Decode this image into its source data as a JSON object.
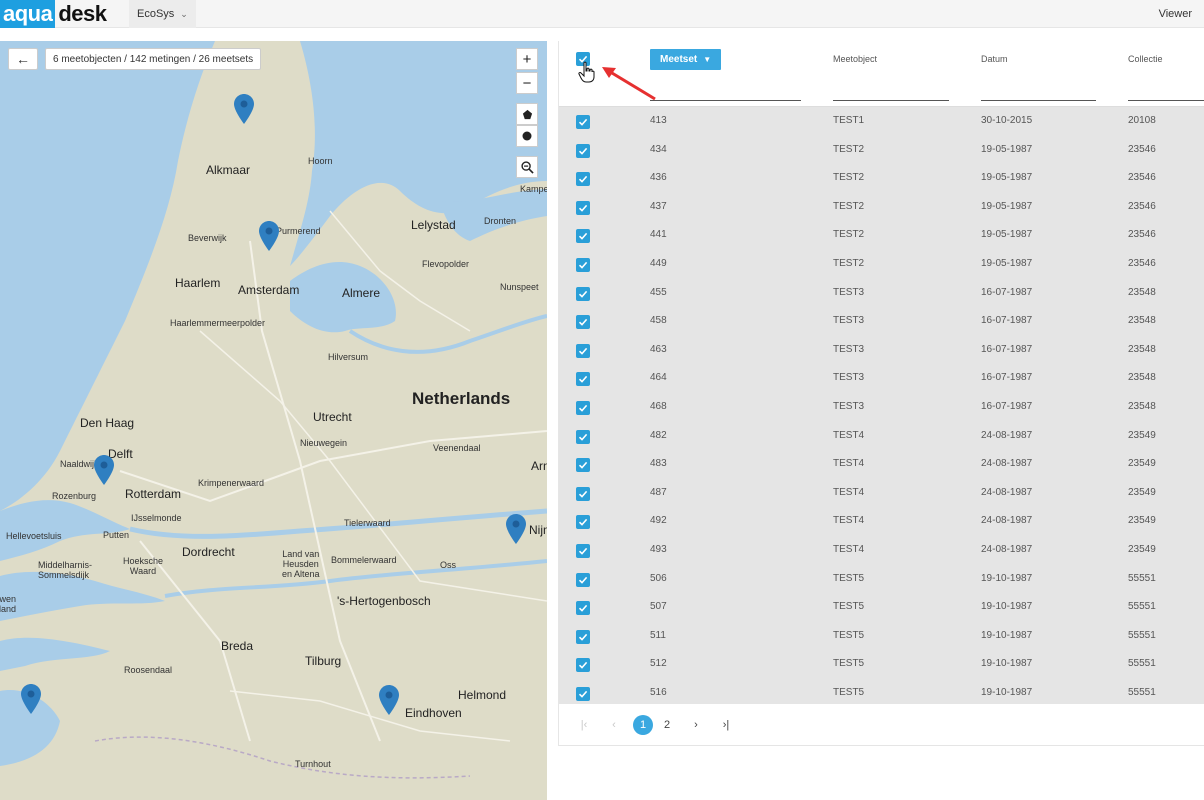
{
  "app": {
    "logo_part1": "aqua",
    "logo_part2": "desk",
    "module": "EcoSys",
    "user_role": "Viewer"
  },
  "map": {
    "summary": "6 meetobjecten / 142 metingen  / 26 meetsets",
    "zoom_in": "+",
    "zoom_out": "−",
    "labels": {
      "alkmaar": "Alkmaar",
      "hoorn": "Hoorn",
      "purmerend": "Purmerend",
      "lelystad": "Lelystad",
      "dronten": "Dronten",
      "kampen": "Kampen",
      "beverwijk": "Beverwijk",
      "flevopolder": "Flevopolder",
      "haarlem": "Haarlem",
      "amsterdam": "Amsterdam",
      "almere": "Almere",
      "nunspeet": "Nunspeet",
      "haarlemmermeerpolder": "Haarlemmermeerpolder",
      "hilversum": "Hilversum",
      "netherlands": "Netherlands",
      "den_haag": "Den Haag",
      "utrecht": "Utrecht",
      "nieuwegein": "Nieuwegein",
      "delft": "Delft",
      "naaldwijk": "Naaldwijk",
      "veenendaal": "Veenendaal",
      "arnhem": "Arnhem",
      "rozenburg": "Rozenburg",
      "rotterdam": "Rotterdam",
      "krimpenerwaard": "Krimpenerwaard",
      "ijsselmonde": "IJsselmonde",
      "hellevoetsluis": "Hellevoetsluis",
      "putten": "Putten",
      "tielerwaard": "Tielerwaard",
      "nijmegen": "Nijmegen",
      "dordrecht": "Dordrecht",
      "hoeksche_waard": "Hoeksche\nWaard",
      "land_van_heusden": "Land van\nHeusden\nen Altena",
      "bommelerwaard": "Bommelerwaard",
      "oss": "Oss",
      "middelharnis": "Middelharnis-\nSommelsdijk",
      "schouwen": "Schouwen\nDuiveland",
      "hertogenbosch": "'s-Hertogenbosch",
      "breda": "Breda",
      "roosendaal": "Roosendaal",
      "tilburg": "Tilburg",
      "helmond": "Helmond",
      "eindhoven": "Eindhoven",
      "turnhout": "Turnhout"
    }
  },
  "table": {
    "meetset_button": "Meetset",
    "columns": [
      "Meetobject",
      "Datum",
      "Collectie"
    ],
    "rows": [
      {
        "meetset": "413",
        "meetobject": "TEST1",
        "datum": "30-10-2015",
        "collectie": "20108"
      },
      {
        "meetset": "434",
        "meetobject": "TEST2",
        "datum": "19-05-1987",
        "collectie": "23546"
      },
      {
        "meetset": "436",
        "meetobject": "TEST2",
        "datum": "19-05-1987",
        "collectie": "23546"
      },
      {
        "meetset": "437",
        "meetobject": "TEST2",
        "datum": "19-05-1987",
        "collectie": "23546"
      },
      {
        "meetset": "441",
        "meetobject": "TEST2",
        "datum": "19-05-1987",
        "collectie": "23546"
      },
      {
        "meetset": "449",
        "meetobject": "TEST2",
        "datum": "19-05-1987",
        "collectie": "23546"
      },
      {
        "meetset": "455",
        "meetobject": "TEST3",
        "datum": "16-07-1987",
        "collectie": "23548"
      },
      {
        "meetset": "458",
        "meetobject": "TEST3",
        "datum": "16-07-1987",
        "collectie": "23548"
      },
      {
        "meetset": "463",
        "meetobject": "TEST3",
        "datum": "16-07-1987",
        "collectie": "23548"
      },
      {
        "meetset": "464",
        "meetobject": "TEST3",
        "datum": "16-07-1987",
        "collectie": "23548"
      },
      {
        "meetset": "468",
        "meetobject": "TEST3",
        "datum": "16-07-1987",
        "collectie": "23548"
      },
      {
        "meetset": "482",
        "meetobject": "TEST4",
        "datum": "24-08-1987",
        "collectie": "23549"
      },
      {
        "meetset": "483",
        "meetobject": "TEST4",
        "datum": "24-08-1987",
        "collectie": "23549"
      },
      {
        "meetset": "487",
        "meetobject": "TEST4",
        "datum": "24-08-1987",
        "collectie": "23549"
      },
      {
        "meetset": "492",
        "meetobject": "TEST4",
        "datum": "24-08-1987",
        "collectie": "23549"
      },
      {
        "meetset": "493",
        "meetobject": "TEST4",
        "datum": "24-08-1987",
        "collectie": "23549"
      },
      {
        "meetset": "506",
        "meetobject": "TEST5",
        "datum": "19-10-1987",
        "collectie": "55551"
      },
      {
        "meetset": "507",
        "meetobject": "TEST5",
        "datum": "19-10-1987",
        "collectie": "55551"
      },
      {
        "meetset": "511",
        "meetobject": "TEST5",
        "datum": "19-10-1987",
        "collectie": "55551"
      },
      {
        "meetset": "512",
        "meetobject": "TEST5",
        "datum": "19-10-1987",
        "collectie": "55551"
      },
      {
        "meetset": "516",
        "meetobject": "TEST5",
        "datum": "19-10-1987",
        "collectie": "55551"
      }
    ]
  },
  "pager": {
    "first": "|‹",
    "prev": "‹",
    "pages": [
      "1",
      "2"
    ],
    "next": "›",
    "last": "›|",
    "current_page": "1"
  },
  "colors": {
    "accent": "#3aa8e0",
    "checkbox": "#2a9fd8",
    "sea": "#a9cde8",
    "land": "#dedcc8",
    "pin": "#2f7fc1",
    "annotation_arrow": "#e63030"
  }
}
